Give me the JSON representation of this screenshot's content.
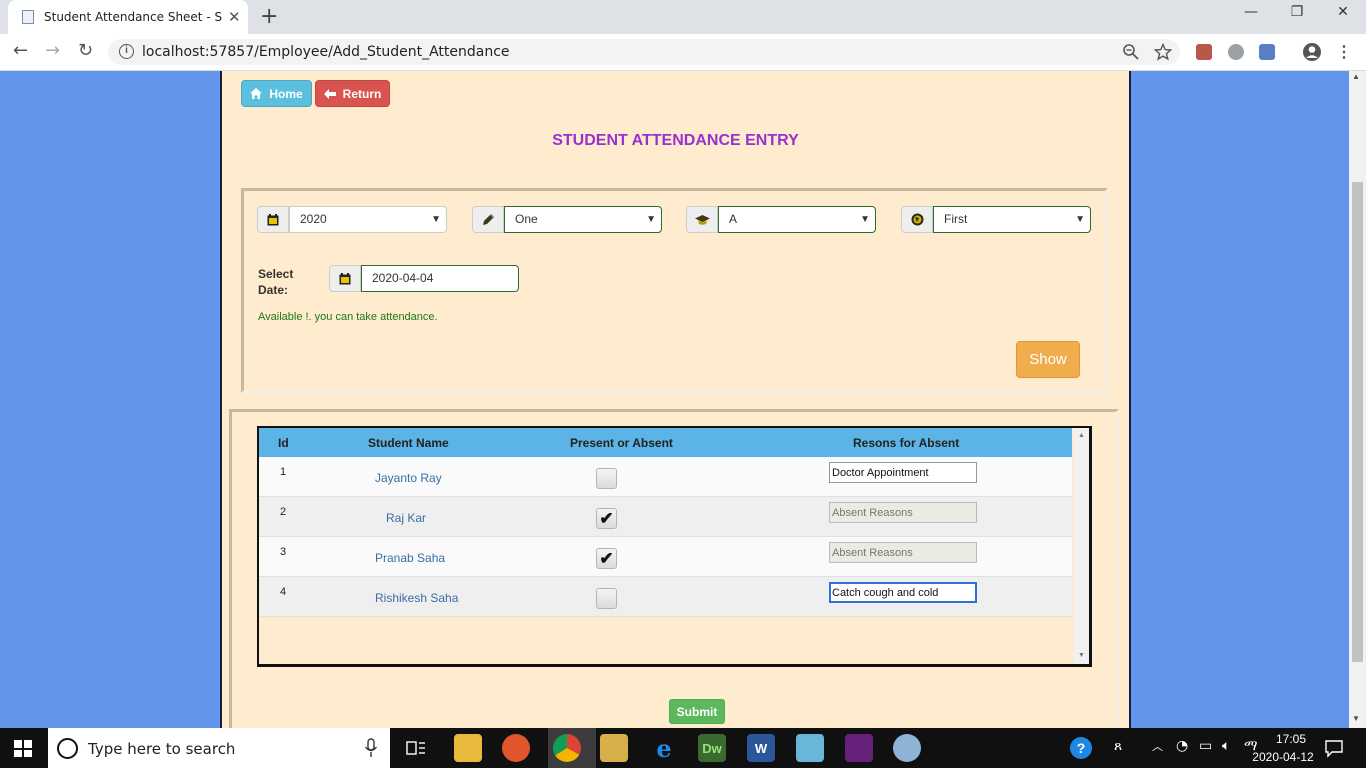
{
  "browser": {
    "tab_title": "Student Attendance Sheet - SCHOOL",
    "tab_close": "✕",
    "new_tab": "+",
    "url": "localhost:57857/Employee/Add_Student_Attendance",
    "window_controls": [
      "—",
      "❐",
      "✕"
    ],
    "nav": {
      "back": "←",
      "forward": "→",
      "reload": "↻"
    }
  },
  "toolbar": {
    "home_label": "Home",
    "return_label": "Return"
  },
  "page": {
    "title": "STUDENT ATTENDANCE ENTRY"
  },
  "filters": {
    "year": "2020",
    "class": "One",
    "section": "A",
    "term": "First",
    "date_label_1": "Select",
    "date_label_2": "Date:",
    "date_value": "2020-04-04",
    "availability_message": "Available !. you can take attendance.",
    "show_label": "Show"
  },
  "grid": {
    "headers": [
      "Id",
      "Student Name",
      "Present or Absent",
      "Resons for Absent"
    ],
    "rows": [
      {
        "id": "1",
        "name": "Jayanto Ray",
        "present": false,
        "reason": "Doctor Appointment",
        "reason_placeholder": "Absent Reasons"
      },
      {
        "id": "2",
        "name": "Raj Kar",
        "present": true,
        "reason": "",
        "reason_placeholder": "Absent Reasons"
      },
      {
        "id": "3",
        "name": "Pranab Saha",
        "present": true,
        "reason": "",
        "reason_placeholder": "Absent Reasons"
      },
      {
        "id": "4",
        "name": "Rishikesh Saha",
        "present": false,
        "reason": "Catch cough and cold",
        "reason_placeholder": "Absent Reasons"
      }
    ],
    "check_mark": "✔"
  },
  "submit_label": "Submit",
  "taskbar": {
    "search_placeholder": "Type here to search",
    "time": "17:05",
    "date": "2020-04-12"
  },
  "colors": {
    "page_bg": "#6495ed",
    "panel_bg": "#ffebcd",
    "title": "#9932cc",
    "home": "#5bc0de",
    "return": "#d9534f",
    "show": "#f0ad4e",
    "submit": "#5cb85c",
    "grid_header": "#5bb4e5"
  }
}
